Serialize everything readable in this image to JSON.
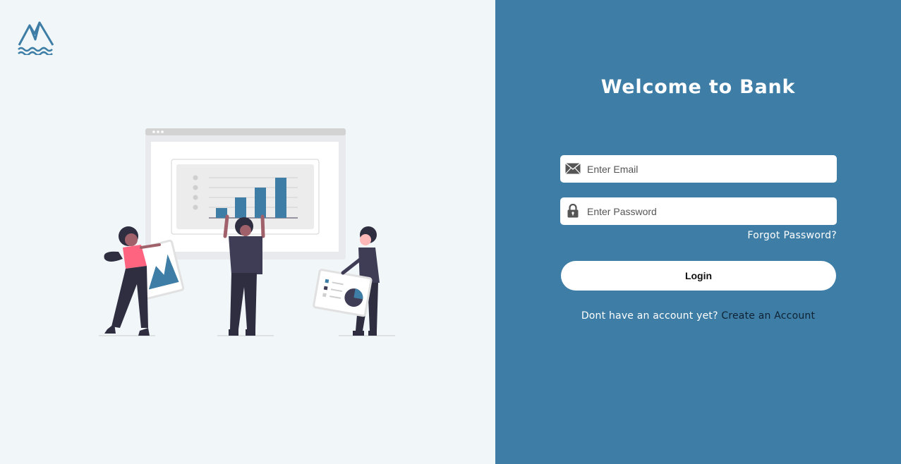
{
  "welcome": {
    "title": "Welcome to Bank"
  },
  "form": {
    "email": {
      "placeholder": "Enter Email",
      "value": "",
      "icon": "envelope-icon"
    },
    "password": {
      "placeholder": "Enter Password",
      "value": "",
      "icon": "lock-icon"
    },
    "forgot_label": "Forgot Password?",
    "login_label": "Login"
  },
  "signup": {
    "prompt": "Dont have an account yet?",
    "link_label": "Create an Account"
  },
  "colors": {
    "left_bg": "#f1f6f9",
    "right_bg": "#3e7ea6",
    "accent": "#3e7ea6",
    "illustration_pink": "#fe6480",
    "illustration_dark": "#2f2e41"
  }
}
